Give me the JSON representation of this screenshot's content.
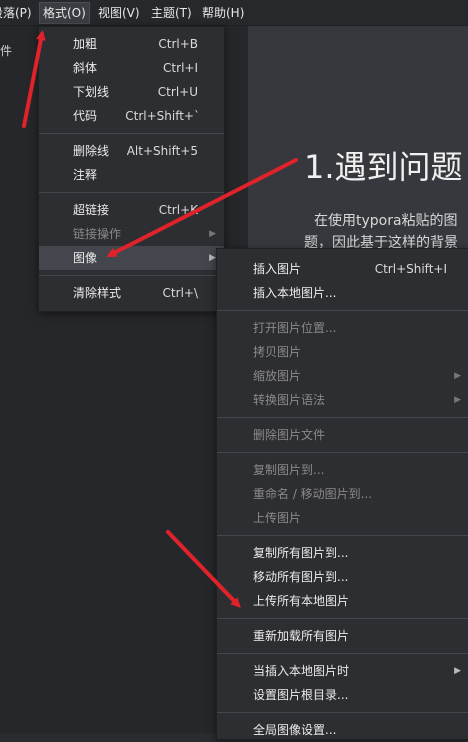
{
  "menubar": {
    "items": [
      {
        "label": "段落(P)"
      },
      {
        "label": "格式(O)"
      },
      {
        "label": "视图(V)"
      },
      {
        "label": "主题(T)"
      },
      {
        "label": "帮助(H)"
      }
    ]
  },
  "sidebar": {
    "fragment": "件"
  },
  "editor": {
    "heading": "1.遇到问题",
    "paragraph_line1": "在使用typora粘贴的图",
    "paragraph_line2": "题，因此基于这样的背景"
  },
  "format_menu": {
    "items": [
      {
        "label": "加粗",
        "shortcut": "Ctrl+B"
      },
      {
        "label": "斜体",
        "shortcut": "Ctrl+I"
      },
      {
        "label": "下划线",
        "shortcut": "Ctrl+U"
      },
      {
        "label": "代码",
        "shortcut": "Ctrl+Shift+`"
      },
      {
        "label": "删除线",
        "shortcut": "Alt+Shift+5"
      },
      {
        "label": "注释",
        "shortcut": ""
      },
      {
        "label": "超链接",
        "shortcut": "Ctrl+K"
      },
      {
        "label": "链接操作",
        "shortcut": ""
      },
      {
        "label": "图像",
        "shortcut": ""
      },
      {
        "label": "清除样式",
        "shortcut": "Ctrl+\\"
      }
    ]
  },
  "image_menu": {
    "items": [
      {
        "label": "插入图片",
        "shortcut": "Ctrl+Shift+I"
      },
      {
        "label": "插入本地图片..."
      },
      {
        "label": "打开图片位置..."
      },
      {
        "label": "拷贝图片"
      },
      {
        "label": "缩放图片"
      },
      {
        "label": "转换图片语法"
      },
      {
        "label": "删除图片文件"
      },
      {
        "label": "复制图片到..."
      },
      {
        "label": "重命名 / 移动图片到..."
      },
      {
        "label": "上传图片"
      },
      {
        "label": "复制所有图片到..."
      },
      {
        "label": "移动所有图片到..."
      },
      {
        "label": "上传所有本地图片"
      },
      {
        "label": "重新加载所有图片"
      },
      {
        "label": "当插入本地图片时"
      },
      {
        "label": "设置图片根目录..."
      },
      {
        "label": "全局图像设置..."
      }
    ]
  },
  "colors": {
    "annotation_arrow": "#e0222a",
    "menu_bg": "#2d2e32",
    "highlight": "#43464c"
  },
  "icons": {
    "submenu": "chevron-right-icon"
  }
}
